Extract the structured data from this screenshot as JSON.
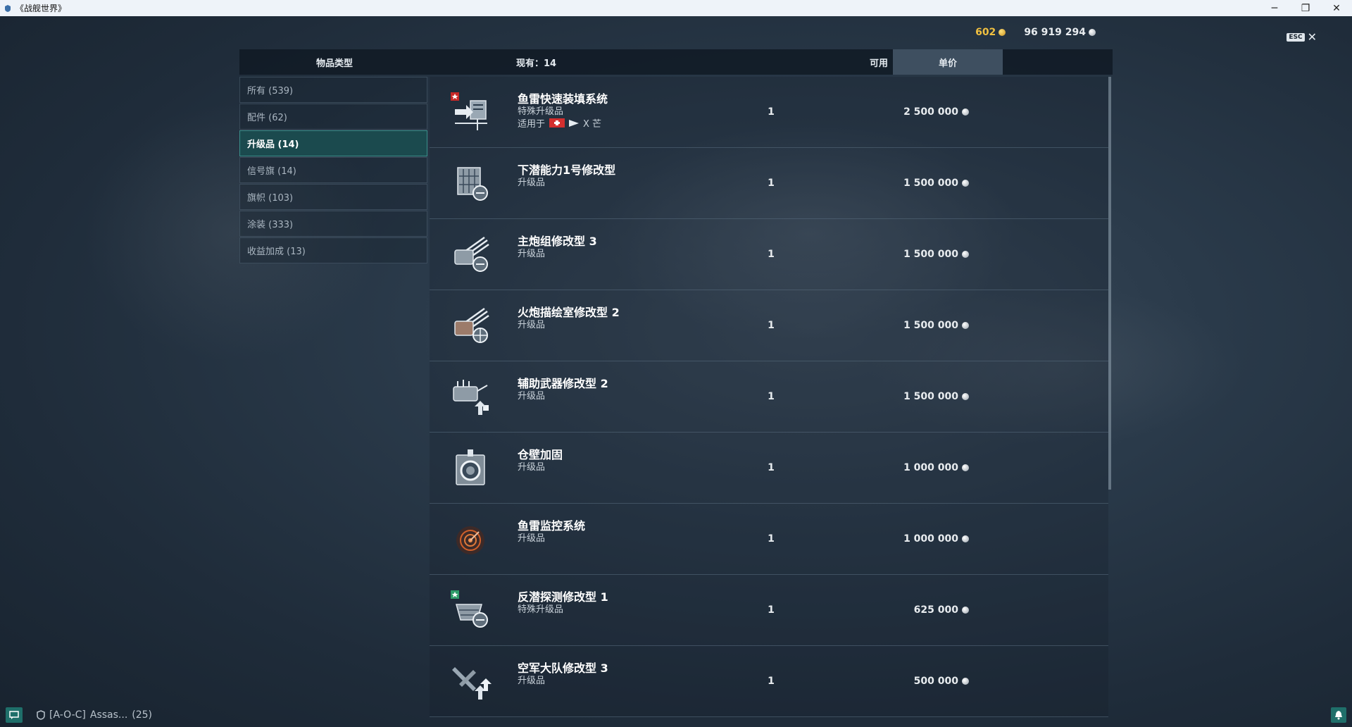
{
  "window": {
    "title": "《战舰世界》",
    "minimize": "─",
    "restore": "❐",
    "close": "✕"
  },
  "currency": {
    "gold": "602",
    "silver": "96 919 294"
  },
  "esc": {
    "key": "ESC",
    "close": "✕"
  },
  "header": {
    "type": "物品类型",
    "have": "现有：14",
    "available": "可用",
    "price": "单价"
  },
  "categories": [
    {
      "label": "所有 (539)"
    },
    {
      "label": "配件 (62)"
    },
    {
      "label": "升级品 (14)"
    },
    {
      "label": "信号旗 (14)"
    },
    {
      "label": "旗帜 (103)"
    },
    {
      "label": "涂装 (333)"
    },
    {
      "label": "收益加成 (13)"
    }
  ],
  "active_category": "升级品 (14)",
  "items": [
    {
      "name": "鱼雷快速装填系统",
      "type": "特殊升级品",
      "applies_label": "适用于",
      "applies_ship": "X 芒",
      "available": "1",
      "price": "2 500 000",
      "icon": "torpedo-reload-icon"
    },
    {
      "name": "下潜能力1号修改型",
      "type": "升级品",
      "available": "1",
      "price": "1 500 000",
      "icon": "submarine-icon"
    },
    {
      "name": "主炮组修改型 3",
      "type": "升级品",
      "available": "1",
      "price": "1 500 000",
      "icon": "main-battery-icon"
    },
    {
      "name": "火炮描绘室修改型 2",
      "type": "升级品",
      "available": "1",
      "price": "1 500 000",
      "icon": "gun-fire-control-icon"
    },
    {
      "name": "辅助武器修改型 2",
      "type": "升级品",
      "available": "1",
      "price": "1 500 000",
      "icon": "aux-armament-icon"
    },
    {
      "name": "仓壁加固",
      "type": "升级品",
      "available": "1",
      "price": "1 000 000",
      "icon": "bulkhead-icon"
    },
    {
      "name": "鱼雷监控系统",
      "type": "升级品",
      "available": "1",
      "price": "1 000 000",
      "icon": "torpedo-lookout-icon"
    },
    {
      "name": "反潜探测修改型 1",
      "type": "特殊升级品",
      "available": "1",
      "price": "625 000",
      "icon": "asw-icon"
    },
    {
      "name": "空军大队修改型 3",
      "type": "升级品",
      "available": "1",
      "price": "500 000",
      "icon": "air-group-icon"
    }
  ],
  "bottom": {
    "clan": "[A-O-C]",
    "name": "Assas...",
    "count": "(25)"
  }
}
